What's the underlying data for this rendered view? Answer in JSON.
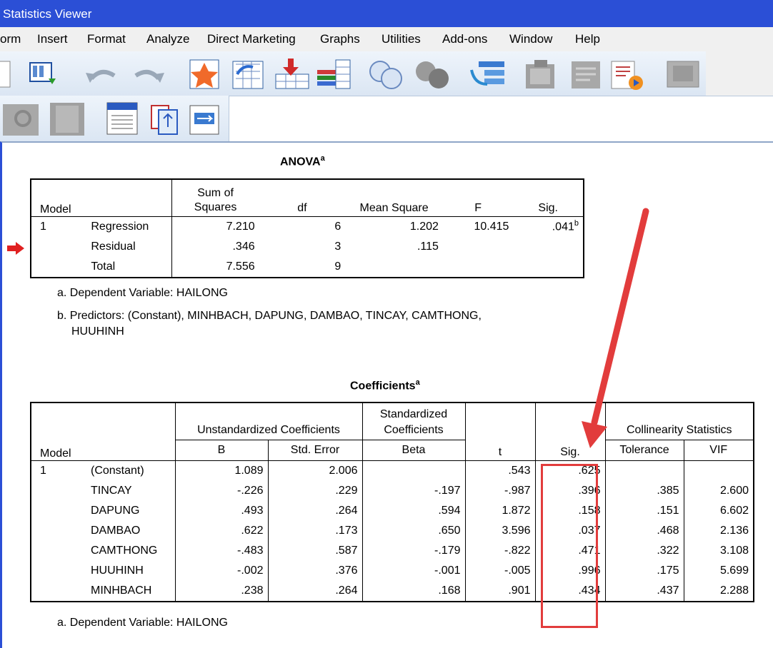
{
  "window": {
    "title": "Statistics Viewer"
  },
  "menu": [
    "orm",
    "Insert",
    "Format",
    "Analyze",
    "Direct Marketing",
    "Graphs",
    "Utilities",
    "Add-ons",
    "Window",
    "Help"
  ],
  "toolbar_icons": [
    "document-icon",
    "export-icon",
    "undo-icon",
    "redo-icon",
    "star-icon",
    "goto-case-icon",
    "insert-case-icon",
    "variables-icon",
    "venn-icon",
    "circles-icon",
    "split-file-icon",
    "designate-window-icon",
    "script-icon",
    "media-icon",
    "hide-icon",
    "zoom-icon",
    "book-icon",
    "output-icon",
    "copy-icon",
    "paste-icon"
  ],
  "anova": {
    "title": "ANOVA",
    "title_sup": "a",
    "headers": {
      "model": "Model",
      "sum1": "Sum of",
      "sum2": "Squares",
      "df": "df",
      "ms": "Mean Square",
      "f": "F",
      "sig": "Sig."
    },
    "rows": [
      {
        "model": "1",
        "name": "Regression",
        "ss": "7.210",
        "df": "6",
        "ms": "1.202",
        "f": "10.415",
        "sig": ".041",
        "sig_sup": "b"
      },
      {
        "model": "",
        "name": "Residual",
        "ss": ".346",
        "df": "3",
        "ms": ".115",
        "f": "",
        "sig": "",
        "sig_sup": ""
      },
      {
        "model": "",
        "name": "Total",
        "ss": "7.556",
        "df": "9",
        "ms": "",
        "f": "",
        "sig": "",
        "sig_sup": ""
      }
    ],
    "footnote_a": "a. Dependent Variable: HAILONG",
    "footnote_b1": "b. Predictors: (Constant), MINHBACH, DAPUNG, DAMBAO, TINCAY, CAMTHONG,",
    "footnote_b2": "HUUHINH"
  },
  "coefficients": {
    "title": "Coefficients",
    "title_sup": "a",
    "headers": {
      "model": "Model",
      "unstd": "Unstandardized Coefficients",
      "std1": "Standardized",
      "std2": "Coefficients",
      "collin": "Collinearity Statistics",
      "b": "B",
      "se": "Std. Error",
      "beta": "Beta",
      "t": "t",
      "sig": "Sig.",
      "tol": "Tolerance",
      "vif": "VIF"
    },
    "rows": [
      {
        "model": "1",
        "name": "(Constant)",
        "b": "1.089",
        "se": "2.006",
        "beta": "",
        "t": ".543",
        "sig": ".625",
        "tol": "",
        "vif": ""
      },
      {
        "model": "",
        "name": "TINCAY",
        "b": "-.226",
        "se": ".229",
        "beta": "-.197",
        "t": "-.987",
        "sig": ".396",
        "tol": ".385",
        "vif": "2.600"
      },
      {
        "model": "",
        "name": "DAPUNG",
        "b": ".493",
        "se": ".264",
        "beta": ".594",
        "t": "1.872",
        "sig": ".158",
        "tol": ".151",
        "vif": "6.602"
      },
      {
        "model": "",
        "name": "DAMBAO",
        "b": ".622",
        "se": ".173",
        "beta": ".650",
        "t": "3.596",
        "sig": ".037",
        "tol": ".468",
        "vif": "2.136"
      },
      {
        "model": "",
        "name": "CAMTHONG",
        "b": "-.483",
        "se": ".587",
        "beta": "-.179",
        "t": "-.822",
        "sig": ".471",
        "tol": ".322",
        "vif": "3.108"
      },
      {
        "model": "",
        "name": "HUUHINH",
        "b": "-.002",
        "se": ".376",
        "beta": "-.001",
        "t": "-.005",
        "sig": ".996",
        "tol": ".175",
        "vif": "5.699"
      },
      {
        "model": "",
        "name": "MINHBACH",
        "b": ".238",
        "se": ".264",
        "beta": ".168",
        "t": ".901",
        "sig": ".434",
        "tol": ".437",
        "vif": "2.288"
      }
    ],
    "footnote_a": "a. Dependent Variable: HAILONG"
  },
  "annotation_color": "#e23c3c"
}
